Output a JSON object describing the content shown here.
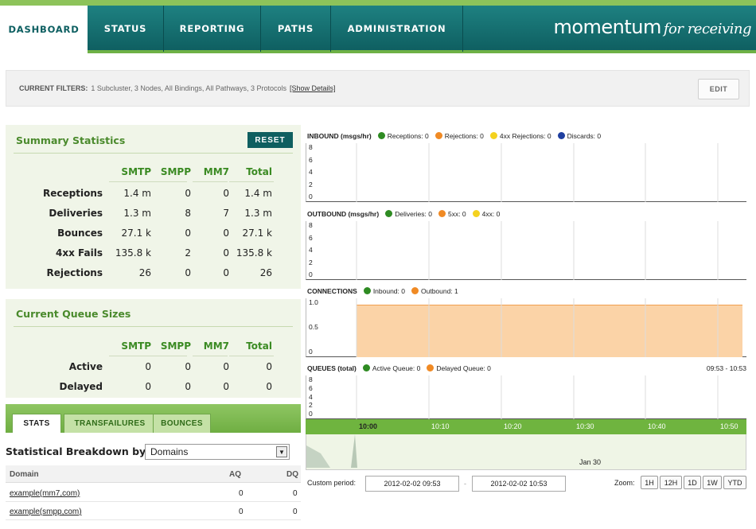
{
  "nav": {
    "tabs": [
      {
        "label": "DASHBOARD",
        "active": true
      },
      {
        "label": "STATUS"
      },
      {
        "label": "REPORTING"
      },
      {
        "label": "PATHS"
      },
      {
        "label": "ADMINISTRATION"
      }
    ],
    "brand": "momentum",
    "brand_suffix": "for receiving"
  },
  "filters": {
    "label": "CURRENT FILTERS:",
    "text": "1 Subcluster, 3 Nodes, All Bindings, All Pathways, 3 Protocols",
    "link": "[Show Details]",
    "edit_label": "EDIT"
  },
  "summary": {
    "title": "Summary Statistics",
    "reset_label": "RESET",
    "columns": [
      "SMTP",
      "SMPP",
      "MM7",
      "Total"
    ],
    "rows": [
      {
        "label": "Receptions",
        "values": [
          "1.4 m",
          "0",
          "0",
          "1.4 m"
        ]
      },
      {
        "label": "Deliveries",
        "values": [
          "1.3 m",
          "8",
          "7",
          "1.3 m"
        ]
      },
      {
        "label": "Bounces",
        "values": [
          "27.1 k",
          "0",
          "0",
          "27.1 k"
        ]
      },
      {
        "label": "4xx Fails",
        "values": [
          "135.8 k",
          "2",
          "0",
          "135.8 k"
        ]
      },
      {
        "label": "Rejections",
        "values": [
          "26",
          "0",
          "0",
          "26"
        ]
      }
    ]
  },
  "queues": {
    "title": "Current Queue Sizes",
    "columns": [
      "SMTP",
      "SMPP",
      "MM7",
      "Total"
    ],
    "rows": [
      {
        "label": "Active",
        "values": [
          "0",
          "0",
          "0",
          "0"
        ]
      },
      {
        "label": "Delayed",
        "values": [
          "0",
          "0",
          "0",
          "0"
        ]
      }
    ]
  },
  "subtabs": [
    {
      "label": "STATS",
      "active": true
    },
    {
      "label": "TRANSFAILURES"
    },
    {
      "label": "BOUNCES"
    }
  ],
  "breakdown": {
    "label": "Statistical Breakdown by",
    "selected": "Domains",
    "columns": [
      "Domain",
      "AQ",
      "DQ"
    ],
    "rows": [
      {
        "domain": "example(mm7,com)",
        "aq": "0",
        "dq": "0"
      },
      {
        "domain": "example(smpp,com)",
        "aq": "0",
        "dq": "0"
      }
    ]
  },
  "charts": {
    "inbound": {
      "title": "INBOUND (msgs/hr)",
      "yticks": [
        "8",
        "6",
        "4",
        "2",
        "0"
      ],
      "legend": [
        {
          "label": "Receptions: 0",
          "color": "#2e8b22"
        },
        {
          "label": "Rejections: 0",
          "color": "#f08a24"
        },
        {
          "label": "4xx Rejections: 0",
          "color": "#f4d21f"
        },
        {
          "label": "Discards: 0",
          "color": "#1f3fa0"
        }
      ]
    },
    "outbound": {
      "title": "OUTBOUND (msgs/hr)",
      "yticks": [
        "8",
        "6",
        "4",
        "2",
        "0"
      ],
      "legend": [
        {
          "label": "Deliveries: 0",
          "color": "#2e8b22"
        },
        {
          "label": "5xx: 0",
          "color": "#f08a24"
        },
        {
          "label": "4xx: 0",
          "color": "#f4d21f"
        }
      ]
    },
    "connections": {
      "title": "CONNECTIONS",
      "yticks": [
        "1.0",
        "0.5",
        "0"
      ],
      "legend": [
        {
          "label": "Inbound: 0",
          "color": "#2e8b22"
        },
        {
          "label": "Outbound: 1",
          "color": "#f08a24"
        }
      ],
      "fill_color": "#fbd3a7",
      "outbound_value": 1
    },
    "queues": {
      "title": "QUEUES (total)",
      "yticks": [
        "8",
        "6",
        "4",
        "2",
        "0"
      ],
      "legend": [
        {
          "label": "Active Queue: 0",
          "color": "#2e8b22"
        },
        {
          "label": "Delayed Queue: 0",
          "color": "#f08a24"
        }
      ],
      "range": "09:53 - 10:53"
    },
    "time_labels": [
      "10:00",
      "10:10",
      "10:20",
      "10:30",
      "10:40",
      "10:50"
    ],
    "overview_label": "Jan 30"
  },
  "period": {
    "label": "Custom period:",
    "start": "2012-02-02 09:53",
    "end": "2012-02-02 10:53",
    "separator": "-",
    "zoom_label": "Zoom:",
    "zoom_buttons": [
      "1H",
      "12H",
      "1D",
      "1W",
      "YTD"
    ]
  }
}
